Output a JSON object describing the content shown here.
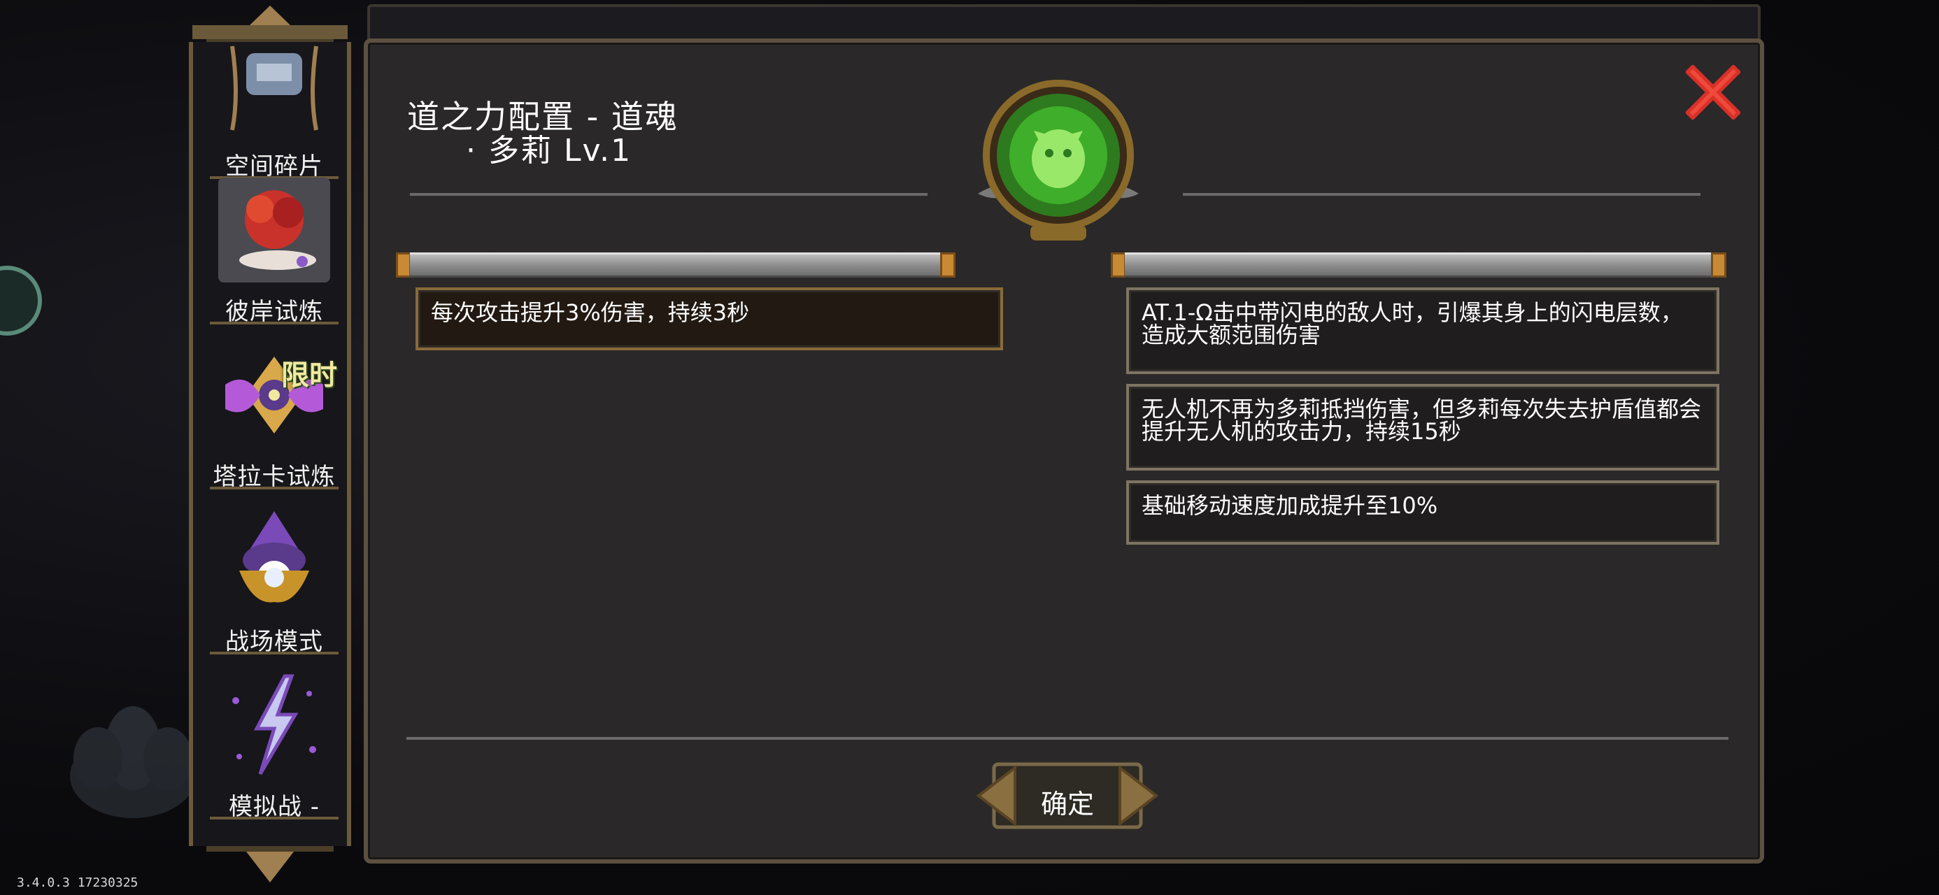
{
  "version_text": "3.4.0.3 17230325",
  "sidebar": {
    "items": [
      {
        "label": "空间碎片",
        "selected": false
      },
      {
        "label": "彼岸试炼",
        "selected": true
      },
      {
        "label": "塔拉卡试炼",
        "selected": false,
        "tag": "限时"
      },
      {
        "label": "战场模式",
        "selected": false
      },
      {
        "label": "模拟战 -",
        "selected": false
      }
    ]
  },
  "dialog": {
    "title": "道之力配置 - 道魂",
    "subtitle": "· 多莉 Lv.1",
    "close_icon": "close-x-icon",
    "left_effects": [
      "每次攻击提升3%伤害，持续3秒"
    ],
    "right_effects": [
      "AT.1-Ω击中带闪电的敌人时，引爆其身上的闪电层数，造成大额范围伤害",
      "无人机不再为多莉抵挡伤害，但多莉每次失去护盾值都会提升无人机的攻击力，持续15秒",
      "基础移动速度加成提升至10%"
    ],
    "confirm_label": "确定"
  },
  "colors": {
    "panel_bg": "#2a2828",
    "frame_gold": "#5c5140",
    "close_red": "#d8312a",
    "emblem_green": "#3fae2a",
    "tag_text": "#f2e8a0"
  }
}
